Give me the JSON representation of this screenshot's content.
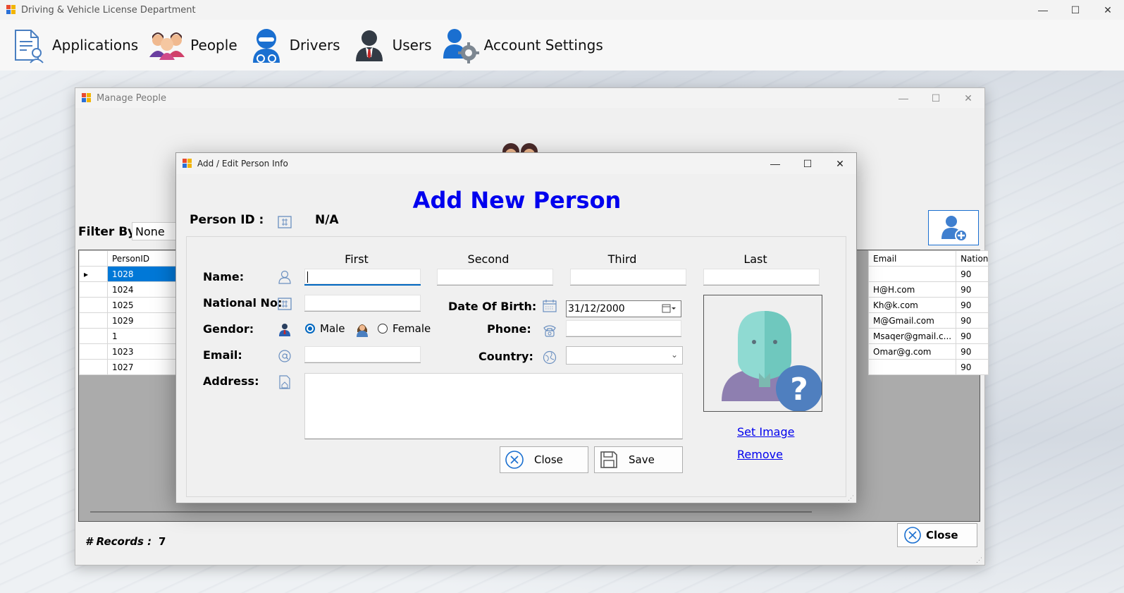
{
  "main_window": {
    "title": "Driving & Vehicle License Department",
    "controls": {
      "minimize": "—",
      "maximize": "☐",
      "close": "✕"
    }
  },
  "menu": {
    "items": [
      {
        "label": "Applications",
        "icon": "applications-document-icon"
      },
      {
        "label": "People",
        "icon": "people-group-icon"
      },
      {
        "label": "Drivers",
        "icon": "driver-helmet-icon"
      },
      {
        "label": "Users",
        "icon": "user-businessman-icon"
      },
      {
        "label": "Account Settings",
        "icon": "account-settings-gear-icon"
      }
    ]
  },
  "manage_people": {
    "title": "Manage People",
    "filter_label": "Filter By :",
    "filter_value": "None",
    "grid": {
      "left_header": "PersonID",
      "right_headers": [
        "Email",
        "National"
      ],
      "rows": [
        {
          "id": "1028",
          "email": "",
          "national": "90",
          "current": true
        },
        {
          "id": "1024",
          "email": "H@H.com",
          "national": "90"
        },
        {
          "id": "1025",
          "email": "Kh@k.com",
          "national": "90"
        },
        {
          "id": "1029",
          "email": "M@Gmail.com",
          "national": "90"
        },
        {
          "id": "1",
          "email": "Msaqer@gmail.c...",
          "national": "90"
        },
        {
          "id": "1023",
          "email": "Omar@g.com",
          "national": "90"
        },
        {
          "id": "1027",
          "email": "",
          "national": "90"
        }
      ]
    },
    "records_label": "# Records :",
    "records_value": "7",
    "close_label": "Close"
  },
  "dialog": {
    "title": "Add / Edit Person Info",
    "heading": "Add New Person",
    "person_id_label": "Person ID :",
    "person_id_value": "N/A",
    "columns": {
      "first": "First",
      "second": "Second",
      "third": "Third",
      "last": "Last"
    },
    "labels": {
      "name": "Name:",
      "national_no": "National No:",
      "gender": "Gendor:",
      "email": "Email:",
      "address": "Address:",
      "date_of_birth": "Date Of Birth:",
      "phone": "Phone:",
      "country": "Country:"
    },
    "values": {
      "first": "",
      "second": "",
      "third": "",
      "last": "",
      "national_no": "",
      "email": "",
      "phone": "",
      "country": "",
      "address": "",
      "date_of_birth": "31/12/2000"
    },
    "gender": {
      "male": "Male",
      "female": "Female",
      "selected": "Male"
    },
    "buttons": {
      "close": "Close",
      "save": "Save"
    },
    "links": {
      "set_image": "Set Image",
      "remove": "Remove"
    },
    "colors": {
      "heading": "#0000ee",
      "accent": "#0067c0"
    }
  }
}
